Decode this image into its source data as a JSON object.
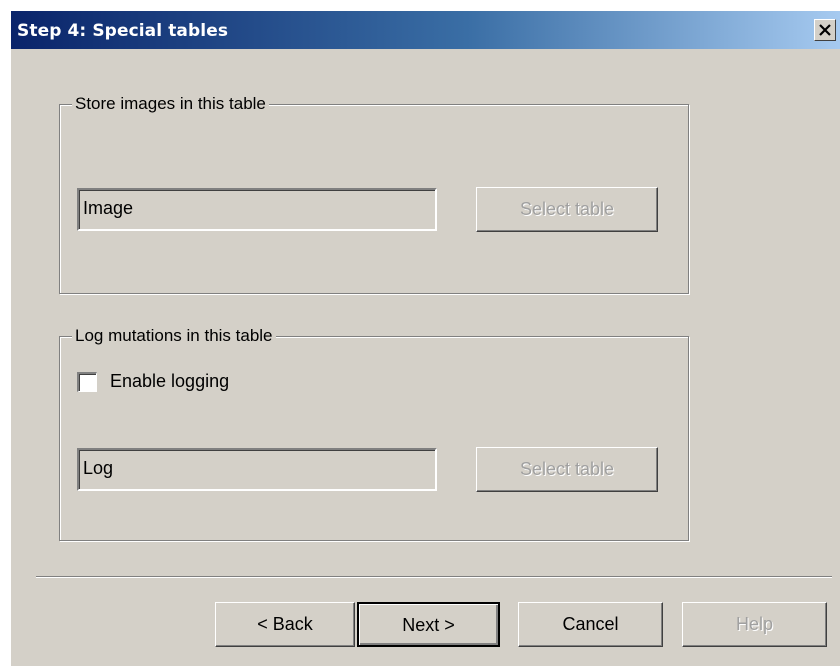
{
  "window": {
    "title": "Step 4: Special tables",
    "close_label": "close"
  },
  "images_group": {
    "legend": "Store images in this table",
    "table_value": "Image",
    "select_label": "Select table"
  },
  "log_group": {
    "legend": "Log mutations in this table",
    "checkbox_label": "Enable logging",
    "checkbox_checked": false,
    "table_value": "Log",
    "select_label": "Select table"
  },
  "footer": {
    "back_label": "< Back",
    "next_label": "Next >",
    "cancel_label": "Cancel",
    "help_label": "Help"
  },
  "colors": {
    "dialog_background": "#d4d0c8",
    "titlebar_start": "#0a246a",
    "titlebar_end": "#a6caf0",
    "disabled_text": "#a0a0a0"
  },
  "icons": {
    "close": "close-icon"
  }
}
